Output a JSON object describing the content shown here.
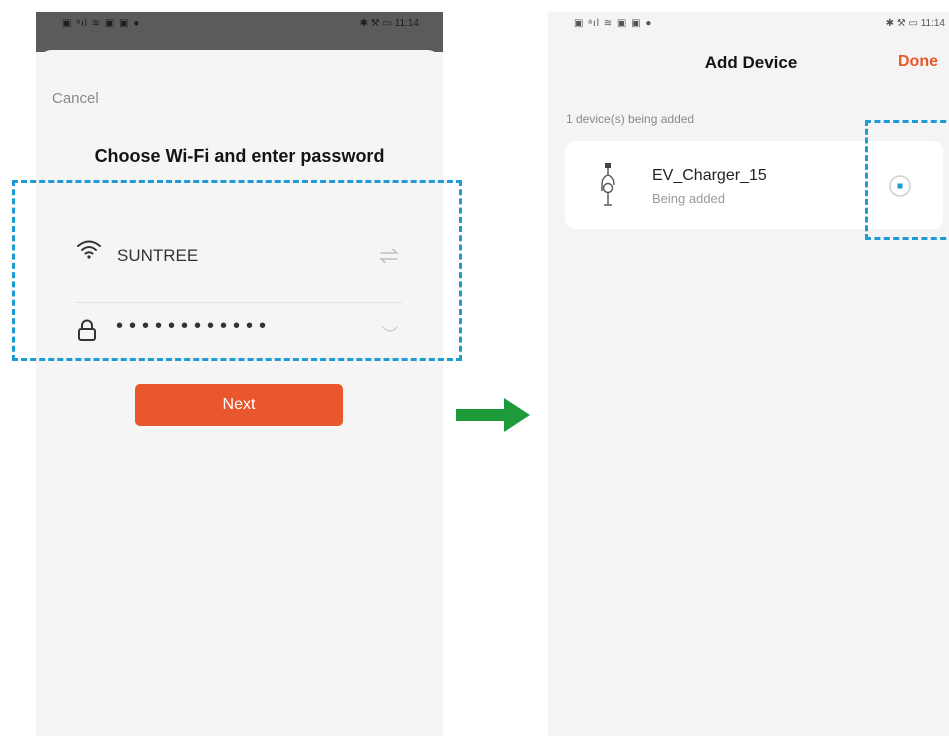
{
  "left_screen": {
    "status_bar": {
      "left_icons": "▣ ᵃıl ≋ ▣ ▣ ●",
      "time": "11:14"
    },
    "cancel_label": "Cancel",
    "heading": "Choose Wi-Fi and enter password",
    "wifi": {
      "ssid": "SUNTREE",
      "icon": "wifi-icon",
      "switch_icon": "swap-icon"
    },
    "password": {
      "masked_value": "••••••••••••",
      "icon": "lock-icon",
      "toggle_icon": "eye-closed-icon"
    },
    "next_label": "Next"
  },
  "right_screen": {
    "status_bar": {
      "left_icons": "▣ ᵃıl ≋ ▣ ▣ ●",
      "time": "11:14"
    },
    "title": "Add Device",
    "done_label": "Done",
    "count_text": "1 device(s) being added",
    "device": {
      "name": "EV_Charger_15",
      "status": "Being added",
      "icon": "ev-charger-icon",
      "state_icon": "loading-spinner-icon"
    }
  },
  "colors": {
    "accent": "#e8582c",
    "highlight": "#1e9ad6",
    "arrow": "#1f9a3a"
  }
}
